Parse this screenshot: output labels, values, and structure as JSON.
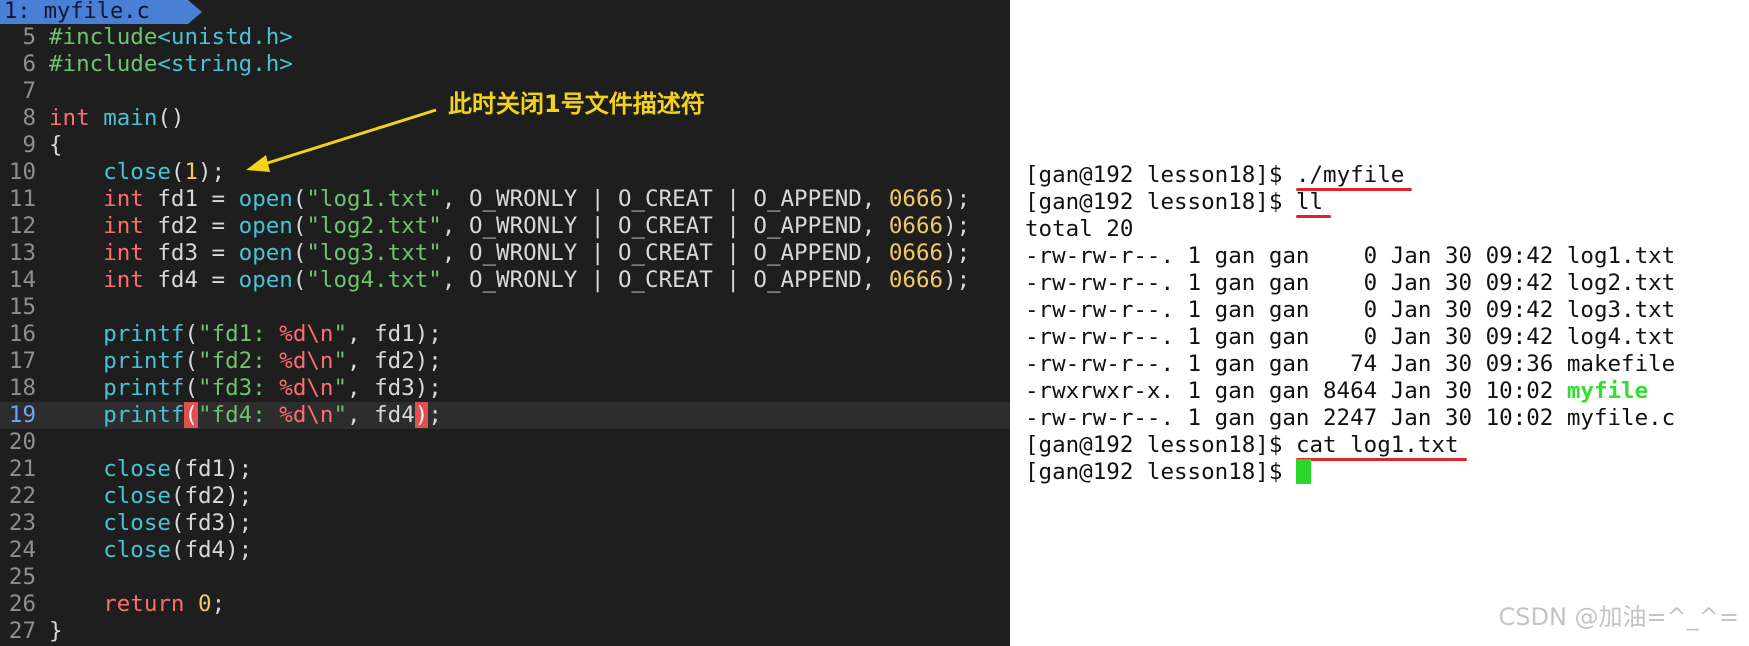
{
  "editor": {
    "tab": {
      "label": "1: myfile.c"
    },
    "lines": [
      {
        "n": "5",
        "parts": [
          {
            "t": "#include",
            "c": "kw-inc"
          },
          {
            "t": "<unistd.h>",
            "c": "inc-hdr"
          }
        ]
      },
      {
        "n": "6",
        "parts": [
          {
            "t": "#include",
            "c": "kw-inc"
          },
          {
            "t": "<string.h>",
            "c": "inc-hdr"
          }
        ]
      },
      {
        "n": "7",
        "parts": []
      },
      {
        "n": "8",
        "parts": [
          {
            "t": "int",
            "c": "type"
          },
          {
            "t": " ",
            "c": "plain"
          },
          {
            "t": "main",
            "c": "fn"
          },
          {
            "t": "()",
            "c": "plain"
          }
        ]
      },
      {
        "n": "9",
        "parts": [
          {
            "t": "{",
            "c": "plain"
          }
        ]
      },
      {
        "n": "10",
        "parts": [
          {
            "t": "    ",
            "c": "plain"
          },
          {
            "t": "close",
            "c": "fn"
          },
          {
            "t": "(",
            "c": "plain"
          },
          {
            "t": "1",
            "c": "num"
          },
          {
            "t": ");",
            "c": "plain"
          }
        ]
      },
      {
        "n": "11",
        "parts": [
          {
            "t": "    ",
            "c": "plain"
          },
          {
            "t": "int",
            "c": "type"
          },
          {
            "t": " fd1 = ",
            "c": "plain"
          },
          {
            "t": "open",
            "c": "fn"
          },
          {
            "t": "(",
            "c": "plain"
          },
          {
            "t": "\"log1.txt\"",
            "c": "str"
          },
          {
            "t": ", O_WRONLY | O_CREAT | O_APPEND, ",
            "c": "plain"
          },
          {
            "t": "0666",
            "c": "num"
          },
          {
            "t": ");",
            "c": "plain"
          }
        ]
      },
      {
        "n": "12",
        "parts": [
          {
            "t": "    ",
            "c": "plain"
          },
          {
            "t": "int",
            "c": "type"
          },
          {
            "t": " fd2 = ",
            "c": "plain"
          },
          {
            "t": "open",
            "c": "fn"
          },
          {
            "t": "(",
            "c": "plain"
          },
          {
            "t": "\"log2.txt\"",
            "c": "str"
          },
          {
            "t": ", O_WRONLY | O_CREAT | O_APPEND, ",
            "c": "plain"
          },
          {
            "t": "0666",
            "c": "num"
          },
          {
            "t": ");",
            "c": "plain"
          }
        ]
      },
      {
        "n": "13",
        "parts": [
          {
            "t": "    ",
            "c": "plain"
          },
          {
            "t": "int",
            "c": "type"
          },
          {
            "t": " fd3 = ",
            "c": "plain"
          },
          {
            "t": "open",
            "c": "fn"
          },
          {
            "t": "(",
            "c": "plain"
          },
          {
            "t": "\"log3.txt\"",
            "c": "str"
          },
          {
            "t": ", O_WRONLY | O_CREAT | O_APPEND, ",
            "c": "plain"
          },
          {
            "t": "0666",
            "c": "num"
          },
          {
            "t": ");",
            "c": "plain"
          }
        ]
      },
      {
        "n": "14",
        "parts": [
          {
            "t": "    ",
            "c": "plain"
          },
          {
            "t": "int",
            "c": "type"
          },
          {
            "t": " fd4 = ",
            "c": "plain"
          },
          {
            "t": "open",
            "c": "fn"
          },
          {
            "t": "(",
            "c": "plain"
          },
          {
            "t": "\"log4.txt\"",
            "c": "str"
          },
          {
            "t": ", O_WRONLY | O_CREAT | O_APPEND, ",
            "c": "plain"
          },
          {
            "t": "0666",
            "c": "num"
          },
          {
            "t": ");",
            "c": "plain"
          }
        ]
      },
      {
        "n": "15",
        "parts": []
      },
      {
        "n": "16",
        "parts": [
          {
            "t": "    ",
            "c": "plain"
          },
          {
            "t": "printf",
            "c": "fn"
          },
          {
            "t": "(",
            "c": "plain"
          },
          {
            "t": "\"fd1: ",
            "c": "str"
          },
          {
            "t": "%d\\n",
            "c": "fmt"
          },
          {
            "t": "\"",
            "c": "str"
          },
          {
            "t": ", fd1);",
            "c": "plain"
          }
        ]
      },
      {
        "n": "17",
        "parts": [
          {
            "t": "    ",
            "c": "plain"
          },
          {
            "t": "printf",
            "c": "fn"
          },
          {
            "t": "(",
            "c": "plain"
          },
          {
            "t": "\"fd2: ",
            "c": "str"
          },
          {
            "t": "%d\\n",
            "c": "fmt"
          },
          {
            "t": "\"",
            "c": "str"
          },
          {
            "t": ", fd2);",
            "c": "plain"
          }
        ]
      },
      {
        "n": "18",
        "parts": [
          {
            "t": "    ",
            "c": "plain"
          },
          {
            "t": "printf",
            "c": "fn"
          },
          {
            "t": "(",
            "c": "plain"
          },
          {
            "t": "\"fd3: ",
            "c": "str"
          },
          {
            "t": "%d\\n",
            "c": "fmt"
          },
          {
            "t": "\"",
            "c": "str"
          },
          {
            "t": ", fd3);",
            "c": "plain"
          }
        ]
      },
      {
        "n": "19",
        "current": true,
        "parts": [
          {
            "t": "    ",
            "c": "plain"
          },
          {
            "t": "printf",
            "c": "fn"
          },
          {
            "t": "(",
            "c": "bracket-hl"
          },
          {
            "t": "\"fd4: ",
            "c": "str"
          },
          {
            "t": "%d\\n",
            "c": "fmt"
          },
          {
            "t": "\"",
            "c": "str"
          },
          {
            "t": ", fd4",
            "c": "plain"
          },
          {
            "t": ")",
            "c": "bracket-hl"
          },
          {
            "t": ";",
            "c": "plain"
          }
        ]
      },
      {
        "n": "20",
        "parts": []
      },
      {
        "n": "21",
        "parts": [
          {
            "t": "    ",
            "c": "plain"
          },
          {
            "t": "close",
            "c": "fn"
          },
          {
            "t": "(fd1);",
            "c": "plain"
          }
        ]
      },
      {
        "n": "22",
        "parts": [
          {
            "t": "    ",
            "c": "plain"
          },
          {
            "t": "close",
            "c": "fn"
          },
          {
            "t": "(fd2);",
            "c": "plain"
          }
        ]
      },
      {
        "n": "23",
        "parts": [
          {
            "t": "    ",
            "c": "plain"
          },
          {
            "t": "close",
            "c": "fn"
          },
          {
            "t": "(fd3);",
            "c": "plain"
          }
        ]
      },
      {
        "n": "24",
        "parts": [
          {
            "t": "    ",
            "c": "plain"
          },
          {
            "t": "close",
            "c": "fn"
          },
          {
            "t": "(fd4);",
            "c": "plain"
          }
        ]
      },
      {
        "n": "25",
        "parts": []
      },
      {
        "n": "26",
        "parts": [
          {
            "t": "    ",
            "c": "plain"
          },
          {
            "t": "return",
            "c": "ret"
          },
          {
            "t": " ",
            "c": "plain"
          },
          {
            "t": "0",
            "c": "num"
          },
          {
            "t": ";",
            "c": "plain"
          }
        ]
      },
      {
        "n": "27",
        "parts": [
          {
            "t": "}",
            "c": "plain"
          }
        ]
      }
    ],
    "annotation": "此时关闭1号文件描述符"
  },
  "terminal": {
    "lines": [
      {
        "prompt": "[gan@192 lesson18]$ ",
        "cmd": "./myfile",
        "underline": true
      },
      {
        "prompt": "[gan@192 lesson18]$ ",
        "cmd": "ll",
        "underline": true
      },
      {
        "text": "total 20"
      },
      {
        "text": "-rw-rw-r--. 1 gan gan    0 Jan 30 09:42 ",
        "file": "log1.txt"
      },
      {
        "text": "-rw-rw-r--. 1 gan gan    0 Jan 30 09:42 ",
        "file": "log2.txt"
      },
      {
        "text": "-rw-rw-r--. 1 gan gan    0 Jan 30 09:42 ",
        "file": "log3.txt"
      },
      {
        "text": "-rw-rw-r--. 1 gan gan    0 Jan 30 09:42 ",
        "file": "log4.txt"
      },
      {
        "text": "-rw-rw-r--. 1 gan gan   74 Jan 30 09:36 ",
        "file": "makefile"
      },
      {
        "text": "-rwxrwxr-x. 1 gan gan 8464 Jan 30 10:02 ",
        "file": "myfile",
        "exec": true
      },
      {
        "text": "-rw-rw-r--. 1 gan gan 2247 Jan 30 10:02 ",
        "file": "myfile.c"
      },
      {
        "prompt": "[gan@192 lesson18]$ ",
        "cmd": "cat log1.txt",
        "underline": true
      },
      {
        "prompt": "[gan@192 lesson18]$ ",
        "cmd": "",
        "cursor": true
      }
    ]
  },
  "colors": {
    "editor_bg": "#1e1e1e",
    "annotation": "#f2d21a",
    "underline": "#e0242c",
    "executable": "#33dd33",
    "cursor": "#2bd62b"
  },
  "watermark": "CSDN @加油=^_^="
}
